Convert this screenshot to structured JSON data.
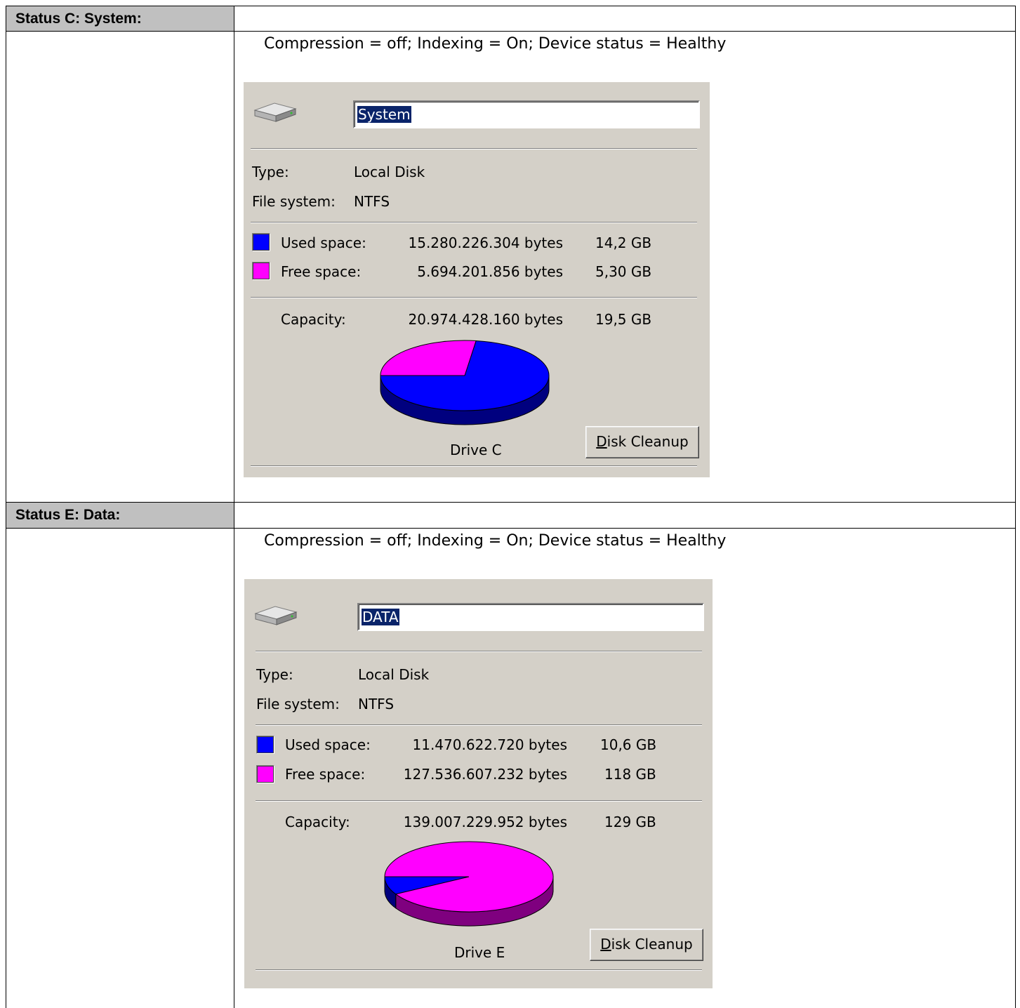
{
  "sections": [
    {
      "heading": "Status C: System:",
      "status": "Compression = off; Indexing = On; Device status = Healthy",
      "drive": {
        "icon": "hard-disk-icon",
        "name": "System",
        "type_label": "Type:",
        "type_value": "Local Disk",
        "fs_label": "File system:",
        "fs_value": "NTFS",
        "used_label": "Used space:",
        "used_bytes": "15.280.226.304 bytes",
        "used_size": "14,2 GB",
        "free_label": "Free space:",
        "free_bytes": "5.694.201.856 bytes",
        "free_size": "5,30 GB",
        "capacity_label": "Capacity:",
        "capacity_bytes": "20.974.428.160 bytes",
        "capacity_size": "19,5 GB",
        "drive_label": "Drive C",
        "cleanup_button": {
          "mnemonic": "D",
          "rest": "isk Cleanup"
        },
        "used_fraction": 0.7285
      }
    },
    {
      "heading": "Status E: Data:",
      "status": "Compression = off; Indexing = On; Device status = Healthy",
      "drive": {
        "icon": "hard-disk-icon",
        "name": "DATA",
        "type_label": "Type:",
        "type_value": "Local Disk",
        "fs_label": "File system:",
        "fs_value": "NTFS",
        "used_label": "Used space:",
        "used_bytes": "11.470.622.720 bytes",
        "used_size": "10,6 GB",
        "free_label": "Free space:",
        "free_bytes": "127.536.607.232 bytes",
        "free_size": "118 GB",
        "capacity_label": "Capacity:",
        "capacity_bytes": "139.007.229.952 bytes",
        "capacity_size": "129 GB",
        "drive_label": "Drive E",
        "cleanup_button": {
          "mnemonic": "D",
          "rest": "isk Cleanup"
        },
        "used_fraction": 0.0825
      }
    }
  ],
  "colors": {
    "used": "#0000ff",
    "used_side": "#00007f",
    "free": "#ff00ff",
    "free_side": "#7f007f",
    "panel": "#d4d0c8",
    "header_cell": "#c0c0c0"
  }
}
